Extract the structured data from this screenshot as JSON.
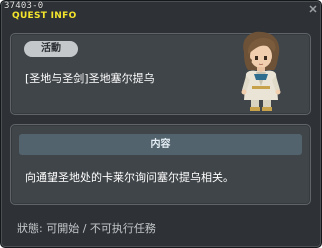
{
  "window": {
    "quest_id": "37403-0",
    "title": "QUEST INFO"
  },
  "activity": {
    "tag": "活動",
    "quest_name": "[圣地与圣剑]圣地塞尔提乌"
  },
  "content": {
    "header": "内容",
    "text": "向通望圣地处的卡莱尔询问塞尔提乌相关。"
  },
  "status": {
    "text": "狀態:  可開始  /  不可执行任務"
  },
  "colors": {
    "title": "#f4e52c",
    "window_bg": "#2e3236",
    "panel_bg": "#404549",
    "header_bar": "#52636e"
  }
}
